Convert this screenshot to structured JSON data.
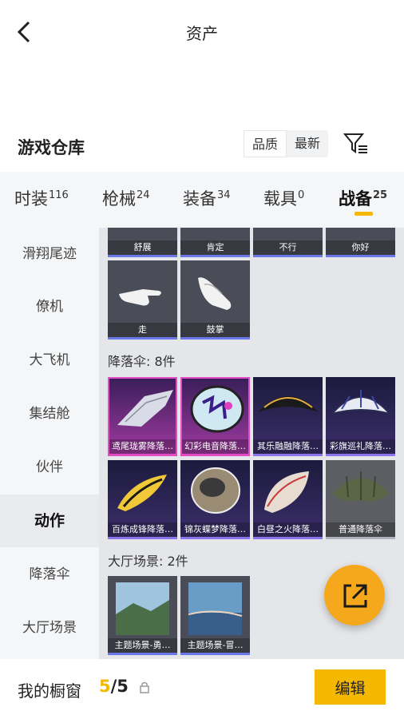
{
  "header": {
    "title": "资产"
  },
  "warehouse": {
    "title": "游戏仓库",
    "sort": [
      "品质",
      "最新"
    ]
  },
  "tabs": [
    {
      "label": "时装",
      "count": "116"
    },
    {
      "label": "枪械",
      "count": "24"
    },
    {
      "label": "装备",
      "count": "34"
    },
    {
      "label": "载具",
      "count": "0"
    },
    {
      "label": "战备",
      "count": "25"
    }
  ],
  "sidebar": [
    "滑翔尾迹",
    "僚机",
    "大飞机",
    "集结舱",
    "伙伴",
    "动作",
    "降落伞",
    "大厅场景"
  ],
  "emotes_partial": [
    "舒展",
    "肯定",
    "不行",
    "你好"
  ],
  "emotes": [
    "走",
    "鼓掌"
  ],
  "parachute_group": {
    "title": "降落伞: 8件"
  },
  "parachutes": [
    "鸢尾珑雾降落…",
    "幻彩电音降落…",
    "其乐融融降落…",
    "彩旗巡礼降落…",
    "百炼成锋降落…",
    "锦灰蝶梦降落…",
    "白昼之火降落…",
    "普通降落伞"
  ],
  "scene_group": {
    "title": "大厅场景: 2件"
  },
  "scenes": [
    "主题场景-勇…",
    "主题场景-冒…"
  ],
  "bottom": {
    "label": "我的橱窗",
    "current": "5",
    "separator": "/",
    "total": "5",
    "edit": "编辑"
  },
  "colors": {
    "accent": "#f5b800",
    "fab": "#f5a81c"
  }
}
